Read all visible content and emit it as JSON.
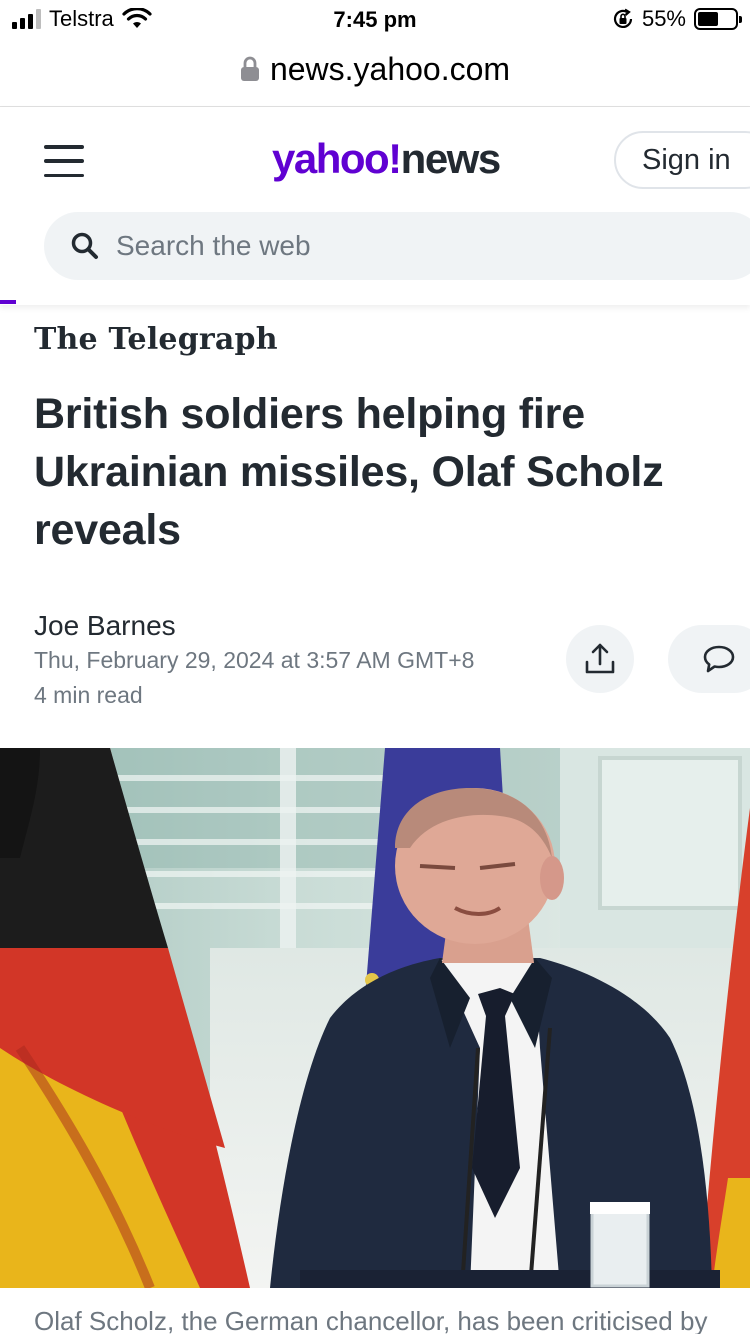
{
  "status_bar": {
    "carrier": "Telstra",
    "time": "7:45 pm",
    "battery": "55%",
    "battery_level": 0.55,
    "icons": [
      "cellular-signal-icon",
      "wifi-icon",
      "orientation-lock-icon",
      "battery-icon"
    ]
  },
  "browser": {
    "url": "news.yahoo.com",
    "icons": [
      "lock-icon"
    ]
  },
  "header": {
    "logo_yahoo": "yahoo!",
    "logo_news": "news",
    "sign_in_label": "Sign in",
    "search_placeholder": "Search the web",
    "icons": [
      "hamburger-menu-icon",
      "search-icon"
    ]
  },
  "article": {
    "publisher": "The Telegraph",
    "headline": "British soldiers helping fire Ukrainian missiles, Olaf Scholz reveals",
    "author": "Joe Barnes",
    "datetime": "Thu, February 29, 2024 at 3:57 AM GMT+8",
    "read_time": "4 min read",
    "caption": "Olaf Scholz, the German chancellor, has been criticised by",
    "icons": [
      "share-icon",
      "comment-icon"
    ]
  },
  "colors": {
    "brand_purple": "#6001d2",
    "text_dark": "#232a31",
    "text_muted": "#6e7780",
    "search_bg": "#f0f3f5"
  }
}
